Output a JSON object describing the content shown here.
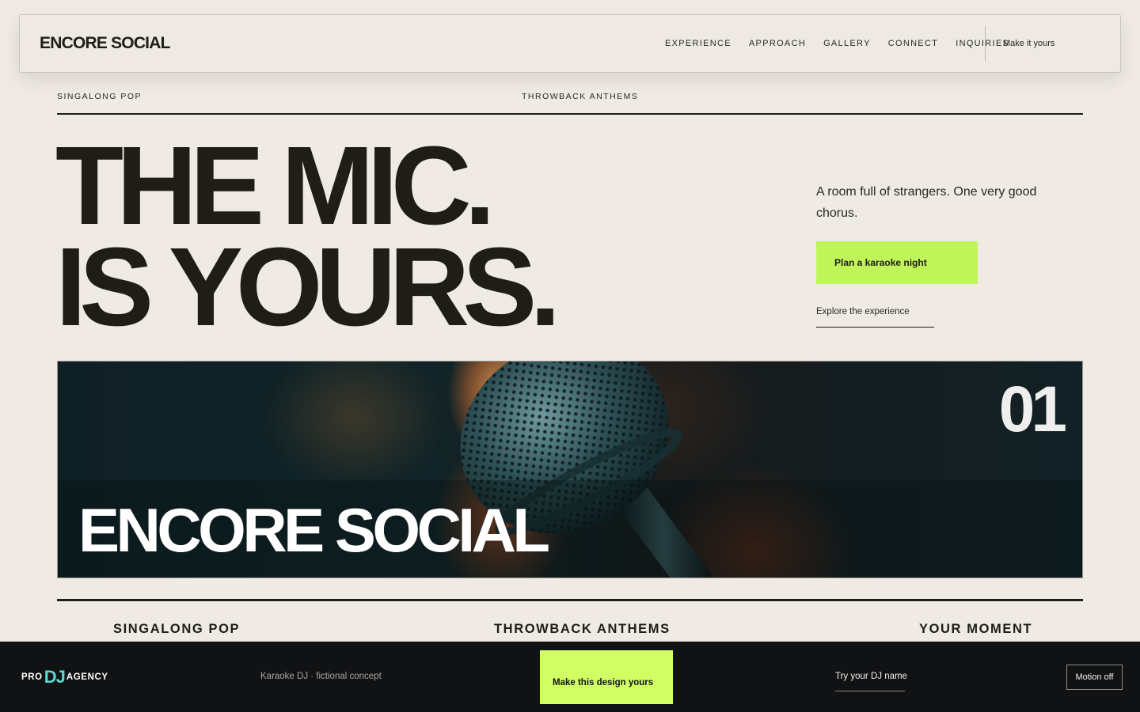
{
  "header": {
    "brand": "ENCORE SOCIAL",
    "nav": [
      "EXPERIENCE",
      "APPROACH",
      "GALLERY",
      "CONNECT",
      "INQUIRIES"
    ],
    "make_link": "Make it yours"
  },
  "tags": {
    "left": "SINGALONG POP",
    "right": "THROWBACK ANTHEMS"
  },
  "hero": {
    "title_line1": "THE MIC.",
    "title_line2": "IS YOURS.",
    "copy": "A room full of strangers. One very good chorus.",
    "cta_label": "Plan a karaoke night",
    "secondary_link": "Explore the experience"
  },
  "feature": {
    "number": "01",
    "title": "ENCORE SOCIAL",
    "image_subject": "microphone-photo"
  },
  "columns": [
    "SINGALONG POP",
    "THROWBACK ANTHEMS",
    "YOUR MOMENT"
  ],
  "footer": {
    "logo_pro": "PRO",
    "logo_dj": "DJ",
    "logo_agency": "AGENCY",
    "note": "Karaoke DJ · fictional concept",
    "cta_label": "Make this design yours",
    "link": "Try your DJ name",
    "motion_toggle": "Motion off"
  },
  "colors": {
    "background": "#efeae3",
    "ink": "#1f1d16",
    "accent_lime": "#c0f55a",
    "footer_bg": "#111214",
    "footer_cta": "#d1ff63",
    "logo_teal": "#5fd6d1"
  }
}
